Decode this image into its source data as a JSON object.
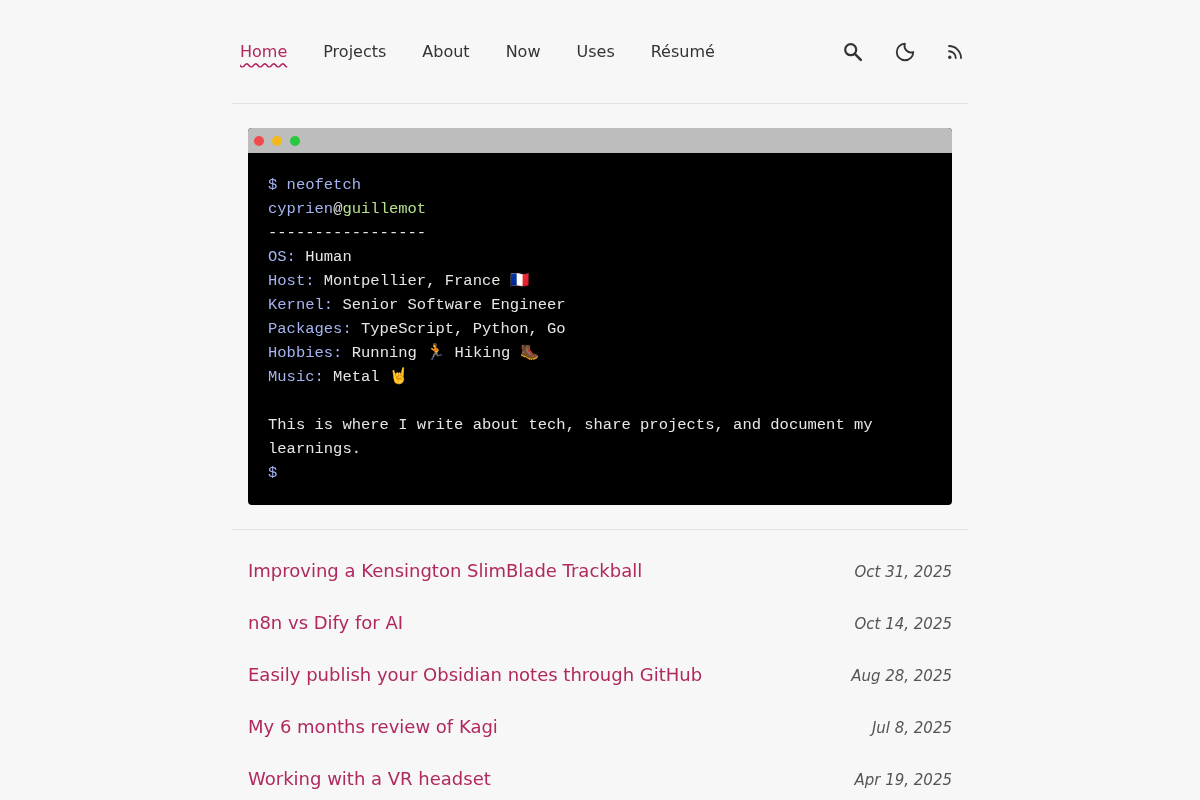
{
  "nav": {
    "links": [
      {
        "label": "Home",
        "selected": true
      },
      {
        "label": "Projects",
        "selected": false
      },
      {
        "label": "About",
        "selected": false
      },
      {
        "label": "Now",
        "selected": false
      },
      {
        "label": "Uses",
        "selected": false
      },
      {
        "label": "Résumé",
        "selected": false
      }
    ]
  },
  "terminal": {
    "output": [
      [
        {
          "kind": "prompt",
          "text": "$ neofetch"
        }
      ],
      [
        {
          "kind": "key",
          "text": "cyprien"
        },
        {
          "kind": "plain",
          "text": "@"
        },
        {
          "kind": "host",
          "text": "guillemot"
        }
      ],
      [
        {
          "kind": "plain",
          "text": "-----------------"
        }
      ],
      [
        {
          "kind": "key",
          "text": "OS:"
        },
        {
          "kind": "plain",
          "text": " Human"
        }
      ],
      [
        {
          "kind": "key",
          "text": "Host:"
        },
        {
          "kind": "plain",
          "text": " Montpellier, France 🇫🇷"
        }
      ],
      [
        {
          "kind": "key",
          "text": "Kernel:"
        },
        {
          "kind": "plain",
          "text": " Senior Software Engineer"
        }
      ],
      [
        {
          "kind": "key",
          "text": "Packages:"
        },
        {
          "kind": "plain",
          "text": " TypeScript, Python, Go"
        }
      ],
      [
        {
          "kind": "key",
          "text": "Hobbies:"
        },
        {
          "kind": "plain",
          "text": " Running 🏃 Hiking 🥾"
        }
      ],
      [
        {
          "kind": "key",
          "text": "Music:"
        },
        {
          "kind": "plain",
          "text": " Metal 🤘"
        }
      ]
    ],
    "message": "This is where I write about tech, share projects, and document my learnings.",
    "prompt": "$"
  },
  "posts": [
    {
      "title": "Improving a Kensington SlimBlade Trackball",
      "date": "Oct 31, 2025"
    },
    {
      "title": "n8n vs Dify for AI",
      "date": "Oct 14, 2025"
    },
    {
      "title": "Easily publish your Obsidian notes through GitHub",
      "date": "Aug 28, 2025"
    },
    {
      "title": "My 6 months review of Kagi",
      "date": "Jul 8, 2025"
    },
    {
      "title": "Working with a VR headset",
      "date": "Apr 19, 2025"
    }
  ]
}
